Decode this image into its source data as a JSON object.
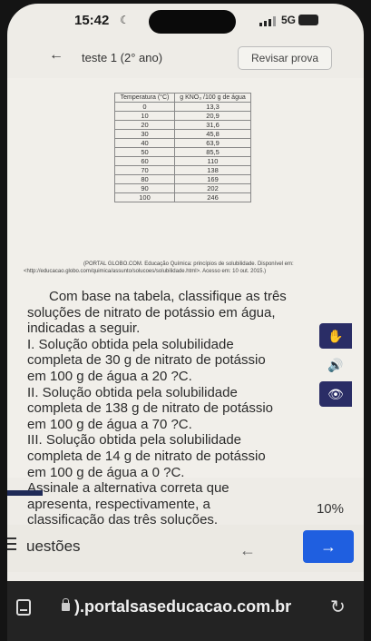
{
  "status": {
    "time": "15:42",
    "network": "5G",
    "battery": ""
  },
  "header": {
    "title": "teste 1 (2° ano)",
    "review_label": "Revisar prova"
  },
  "table": {
    "headers": [
      "Temperatura (°C)",
      "g KNO₃ /100 g de água"
    ],
    "rows": [
      [
        "0",
        "13,3"
      ],
      [
        "10",
        "20,9"
      ],
      [
        "20",
        "31,6"
      ],
      [
        "30",
        "45,8"
      ],
      [
        "40",
        "63,9"
      ],
      [
        "50",
        "85,5"
      ],
      [
        "60",
        "110"
      ],
      [
        "70",
        "138"
      ],
      [
        "80",
        "169"
      ],
      [
        "90",
        "202"
      ],
      [
        "100",
        "246"
      ]
    ],
    "source_line1": "(PORTAL GLOBO.COM. Educação Química: princípios de solubilidade. Disponível em:",
    "source_line2": "<http://educacao.globo.com/quimica/assunto/solucoes/solubilidade.html>. Acesso em: 10 out. 2015.)"
  },
  "question": {
    "lines": [
      "Com base na tabela, classifique as três",
      "soluções de nitrato de potássio em água,",
      "indicadas a seguir.",
      "I. Solução obtida pela solubilidade",
      "completa de 30 g de nitrato de potássio",
      "em 100 g de água a 20 ?C.",
      "II. Solução obtida pela solubilidade",
      "completa de 138 g de nitrato de potássio",
      "em 100 g de água a 70 ?C.",
      "III. Solução obtida pela solubilidade",
      "completa de 14 g de nitrato de potássio",
      "em 100 g de água a 0 ?C.",
      "Assinale a alternativa correta que",
      "apresenta, respectivamente, a",
      "classificação das três soluções."
    ]
  },
  "progress": {
    "percent_label": "10%",
    "fraction": 0.1
  },
  "nav": {
    "label": "uestões",
    "prev": "←",
    "next": "→"
  },
  "browser": {
    "url": ").portalsaseducacao.com.br"
  },
  "colors": {
    "accent": "#1f5fe0",
    "widget": "#2a2d66",
    "progress": "#1f2a57"
  }
}
